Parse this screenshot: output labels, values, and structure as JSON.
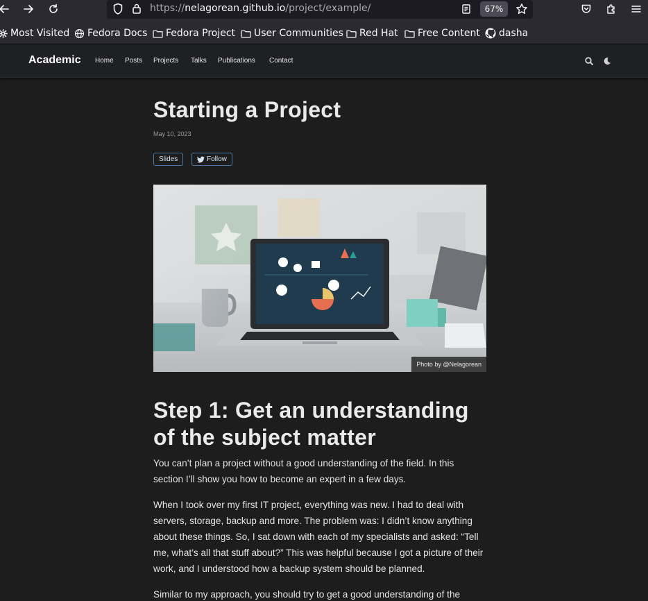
{
  "browser": {
    "url_scheme": "https://",
    "url_host": "nelagorean.github.io",
    "url_path": "/project/example/",
    "zoom": "67%",
    "icons": [
      "back-icon",
      "forward-icon",
      "reload-icon",
      "shield-icon",
      "lock-icon",
      "reader-mode-icon",
      "star-icon",
      "pocket-icon",
      "extensions-icon",
      "menu-icon"
    ]
  },
  "bookmarks": [
    {
      "label": "Most Visited",
      "icon": "gear-icon"
    },
    {
      "label": "Fedora Docs",
      "icon": "globe-icon"
    },
    {
      "label": "Fedora Project",
      "icon": "folder-icon"
    },
    {
      "label": "User Communities",
      "icon": "folder-icon"
    },
    {
      "label": "Red Hat",
      "icon": "folder-icon"
    },
    {
      "label": "Free Content",
      "icon": "folder-icon"
    },
    {
      "label": "dasha",
      "icon": "github-icon"
    }
  ],
  "site": {
    "brand": "Academic",
    "nav": [
      "Home",
      "Posts",
      "Projects",
      "Talks",
      "Publications",
      "Contact"
    ],
    "icons": [
      "search-icon",
      "moon-icon"
    ]
  },
  "article": {
    "title": "Starting a Project",
    "date": "May 10, 2023",
    "slides_label": "Slides",
    "follow_label": "Follow",
    "image_caption": "Photo by @Nelagorean",
    "heading": "Step 1: Get an understanding of the subject matter",
    "paragraphs": [
      "You can’t plan a project without a good understanding of the field. In this section I’ll show you how to become an expert in a few days.",
      "When I took over my first IT project, everything was new. I had to deal with servers, storage, backup and more. The problem was: I didn’t know anything about these things. So, I sat down with each of my specialists and asked: “Tell me, what’s all that stuff about?” This was helpful because I got a picture of their work, and I understood how a backup system should be planned.",
      "Similar to my approach, you should try to get a good understanding of the"
    ]
  },
  "colors": {
    "browser_chrome": "#2b2a33",
    "page_background": "#1d1d1d",
    "navbar": "#1f2023",
    "accent_border": "#4a7ba8"
  }
}
